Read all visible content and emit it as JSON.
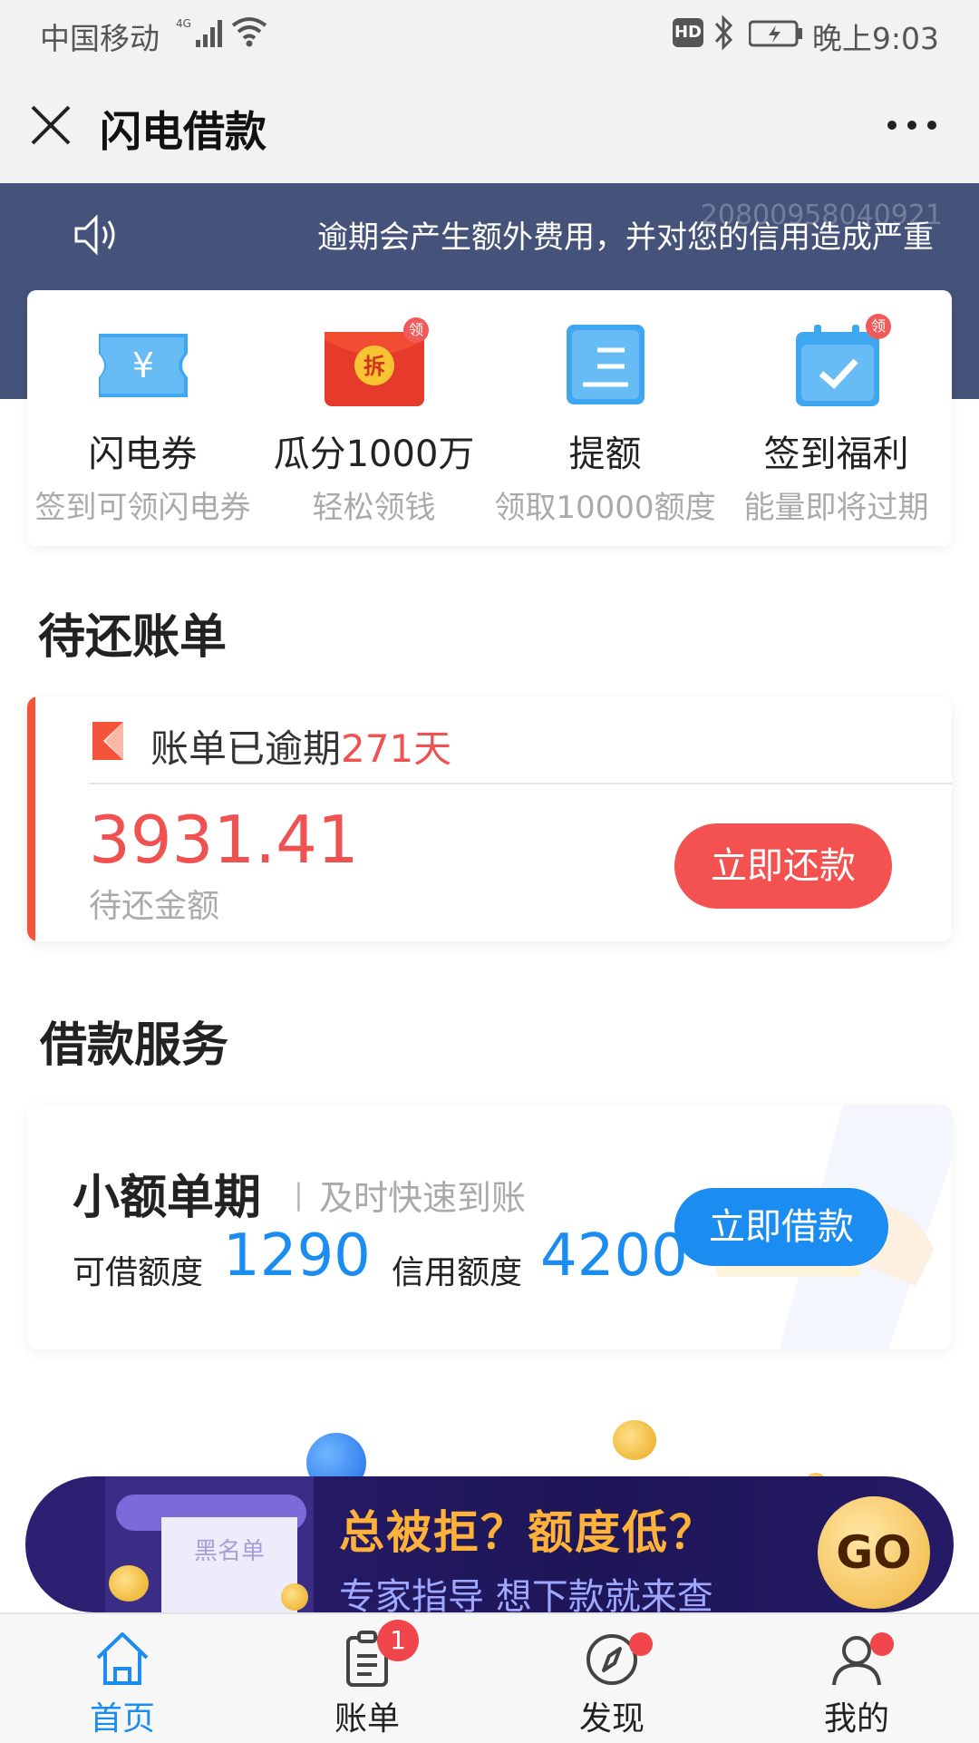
{
  "status_bar": {
    "carrier": "中国移动",
    "network": "4G",
    "hd": "HD",
    "time": "晚上9:03"
  },
  "nav": {
    "title": "闪电借款"
  },
  "notice": {
    "text": "逾期会产生额外费用，并对您的信用造成严重",
    "serial": "20800958040921"
  },
  "quick_actions": [
    {
      "title": "闪电券",
      "subtitle": "签到可领闪电券",
      "icon": "ticket-icon"
    },
    {
      "title": "瓜分1000万",
      "subtitle": "轻松领钱",
      "icon": "red-envelope-icon",
      "tag": "领",
      "envelope_text": "拆"
    },
    {
      "title": "提额",
      "subtitle": "领取10000额度",
      "icon": "document-icon"
    },
    {
      "title": "签到福利",
      "subtitle": "能量即将过期",
      "icon": "calendar-check-icon",
      "tag": "领"
    }
  ],
  "bills": {
    "section_title": "待还账单",
    "status_prefix": "账单已逾期",
    "overdue_days": "271天",
    "amount": "3931.41",
    "amount_label": "待还金额",
    "action": "立即还款"
  },
  "loan": {
    "section_title": "借款服务",
    "product": "小额单期",
    "separator": "|",
    "tagline": "及时快速到账",
    "available_label": "可借额度",
    "available": "1290",
    "credit_label": "信用额度",
    "credit": "4200",
    "action": "立即借款"
  },
  "promo": {
    "headline": "总被拒？额度低？",
    "subtext": "专家指导 想下款就来查",
    "paper_text": "黑名单",
    "button": "GO"
  },
  "tabs": [
    {
      "label": "首页",
      "icon": "home-icon",
      "active": true
    },
    {
      "label": "账单",
      "icon": "bill-icon",
      "badge": "1"
    },
    {
      "label": "发现",
      "icon": "compass-icon"
    },
    {
      "label": "我的",
      "icon": "user-icon"
    }
  ],
  "colors": {
    "banner": "#45537a",
    "accent_blue": "#1b8cf0",
    "accent_red": "#f05252"
  }
}
